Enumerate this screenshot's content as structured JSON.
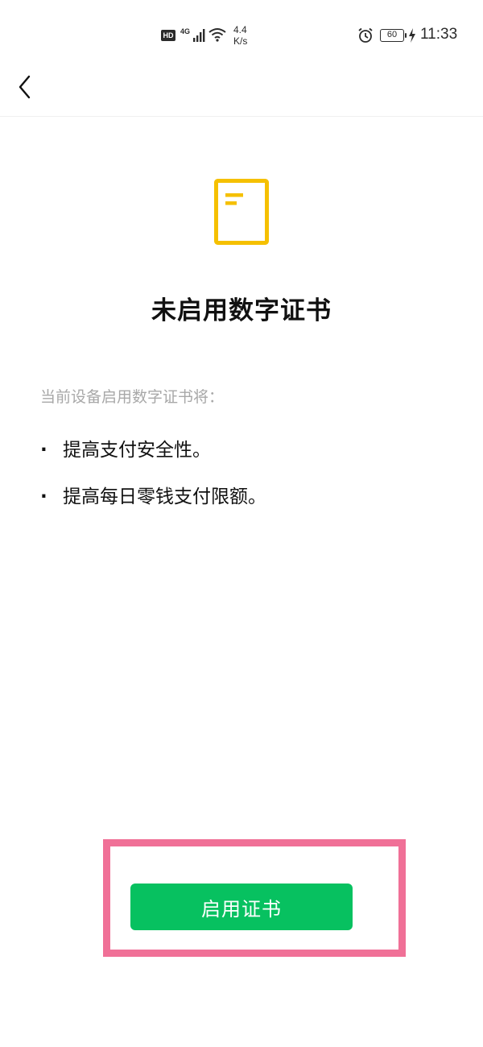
{
  "status_bar": {
    "hd": "HD",
    "network": "4G",
    "speed_value": "4.4",
    "speed_unit": "K/s",
    "battery": "60",
    "time": "11:33"
  },
  "nav": {
    "back_icon": "chevron-left-icon"
  },
  "hero": {
    "icon": "document-icon",
    "icon_color": "#f5c000",
    "title": "未启用数字证书"
  },
  "content": {
    "intro": "当前设备启用数字证书将：",
    "bullet": "·",
    "benefits": [
      "提高支付安全性。",
      "提高每日零钱支付限额。"
    ]
  },
  "action": {
    "enable_label": "启用证书",
    "button_color": "#07c160",
    "highlight_color": "#f07097"
  }
}
